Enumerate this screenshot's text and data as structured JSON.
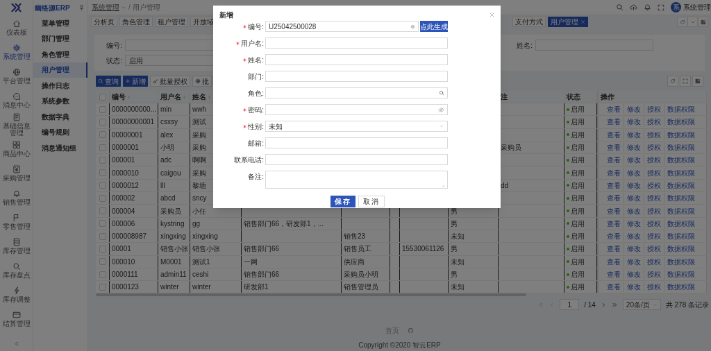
{
  "app": {
    "logo_text": "幽络源ERP"
  },
  "rail": [
    {
      "label": "仪表板",
      "selected": false
    },
    {
      "label": "系统管理",
      "selected": true
    },
    {
      "label": "平台管理",
      "selected": false
    },
    {
      "label": "消息中心",
      "selected": false
    },
    {
      "label": "基础信息管理",
      "selected": false
    },
    {
      "label": "商品中心",
      "selected": false
    },
    {
      "label": "采购管理",
      "selected": false
    },
    {
      "label": "销售管理",
      "selected": false
    },
    {
      "label": "零售管理",
      "selected": false
    },
    {
      "label": "库存管理",
      "selected": false
    },
    {
      "label": "库存盘点",
      "selected": false
    },
    {
      "label": "库存调整",
      "selected": false
    },
    {
      "label": "结算管理",
      "selected": false
    }
  ],
  "submenu": [
    {
      "label": "菜单管理",
      "selected": false
    },
    {
      "label": "部门管理",
      "selected": false
    },
    {
      "label": "角色管理",
      "selected": false
    },
    {
      "label": "用户管理",
      "selected": true
    },
    {
      "label": "操作日志",
      "selected": false
    },
    {
      "label": "系统参数",
      "selected": false
    },
    {
      "label": "数据字典",
      "selected": false
    },
    {
      "label": "编号规则",
      "selected": false
    },
    {
      "label": "消息通知组",
      "selected": false
    }
  ],
  "topbar": {
    "breadcrumb": [
      "系统管理",
      "用户管理"
    ],
    "separator": "/",
    "user_initial": "系",
    "user_name": "系统管理"
  },
  "tabs": [
    {
      "label": "分析页",
      "selected": false
    },
    {
      "label": "角色管理",
      "selected": false
    },
    {
      "label": "租户管理",
      "selected": false
    },
    {
      "label": "开放域",
      "selected": false
    },
    {
      "label": "支付方式",
      "selected": false
    },
    {
      "label": "用户管理",
      "selected": true,
      "closable": true
    }
  ],
  "filters": {
    "id_label": "编号:",
    "name_label": "姓名:",
    "status_label": "状态:",
    "status_value": "启用"
  },
  "toolbar": [
    "查询",
    "新增",
    "批量授权",
    "批"
  ],
  "table": {
    "header_checked": false,
    "headers": {
      "id": {
        "label": "编号",
        "sortable": true
      },
      "username": {
        "label": "用户名",
        "sortable": true
      },
      "name": {
        "label": "姓名",
        "sortable": true
      },
      "remark": {
        "label": "注"
      },
      "status": {
        "label": "状态"
      },
      "actions": {
        "label": "操作"
      }
    },
    "rows": [
      {
        "checked": false,
        "id": "0000000000...",
        "username": "min",
        "name": "wwh",
        "status": "启用",
        "enabled": true,
        "actions": [
          "查看",
          "修改",
          "授权",
          "数据权限"
        ]
      },
      {
        "checked": false,
        "id": "00000000001",
        "username": "csxsy",
        "name": "测试",
        "status": "启用",
        "enabled": true,
        "actions": [
          "查看",
          "修改",
          "授权",
          "数据权限"
        ]
      },
      {
        "checked": false,
        "id": "00000001",
        "username": "alex",
        "name": "采购",
        "status": "启用",
        "enabled": true,
        "actions": [
          "查看",
          "修改",
          "授权",
          "数据权限"
        ]
      },
      {
        "checked": false,
        "id": "0000001",
        "username": "小明",
        "name": "采购",
        "remark": "采购员",
        "status": "启用",
        "enabled": true,
        "actions": [
          "查看",
          "修改",
          "授权",
          "数据权限"
        ]
      },
      {
        "checked": false,
        "id": "000001",
        "username": "adc",
        "name": "啊啊",
        "status": "启用",
        "enabled": true,
        "actions": [
          "查看",
          "修改",
          "授权",
          "数据权限"
        ]
      },
      {
        "checked": false,
        "id": "0000010",
        "username": "caigou",
        "name": "采购",
        "status": "启用",
        "enabled": true,
        "actions": [
          "查看",
          "修改",
          "授权",
          "数据权限"
        ]
      },
      {
        "checked": false,
        "id": "0000012",
        "username": "lll",
        "name": "黎塘",
        "remark": "dd",
        "status": "启用",
        "enabled": true,
        "actions": [
          "查看",
          "修改",
          "授权",
          "数据权限"
        ]
      },
      {
        "checked": false,
        "id": "000002",
        "username": "abcd",
        "name": "sncy",
        "status": "启用",
        "enabled": true,
        "actions": [
          "查看",
          "修改",
          "授权",
          "数据权限"
        ]
      },
      {
        "checked": false,
        "id": "000004",
        "username": "采购员",
        "name": "小任",
        "gender": "男",
        "status": "启用",
        "enabled": true,
        "actions": [
          "查看",
          "修改",
          "授权",
          "数据权限"
        ]
      },
      {
        "checked": false,
        "id": "000006",
        "username": "kystring",
        "name": "gg",
        "dept": "销售部门66，研发部1，...",
        "gender": "男",
        "status": "启用",
        "enabled": true,
        "actions": [
          "查看",
          "修改",
          "授权",
          "数据权限"
        ]
      },
      {
        "checked": false,
        "id": "000008987",
        "username": "xingxing",
        "name": "xingxing",
        "role": "销售23",
        "gender": "未知",
        "status": "启用",
        "enabled": true,
        "actions": [
          "查看",
          "修改",
          "授权",
          "数据权限"
        ]
      },
      {
        "checked": false,
        "id": "00001",
        "username": "销售小张",
        "name": "销售小张",
        "dept": "销售部门66",
        "role": "销售员工",
        "phone": "15530061126",
        "gender": "男",
        "status": "启用",
        "enabled": true,
        "actions": [
          "查看",
          "修改",
          "授权",
          "数据权限"
        ]
      },
      {
        "checked": false,
        "id": "000010",
        "username": "M0001",
        "name": "测试1",
        "dept": "一网",
        "role": "供应商",
        "gender": "未知",
        "status": "启用",
        "enabled": true,
        "actions": [
          "查看",
          "修改",
          "授权",
          "数据权限"
        ]
      },
      {
        "checked": false,
        "id": "0000111",
        "username": "admin11",
        "name": "ceshi",
        "dept": "销售部门66",
        "role": "采购员小明",
        "gender": "男",
        "status": "启用",
        "enabled": true,
        "actions": [
          "查看",
          "修改",
          "授权",
          "数据权限"
        ]
      },
      {
        "checked": false,
        "id": "0000123",
        "username": "winter",
        "name": "winter",
        "dept": "研发部1",
        "role": "销售管理员",
        "gender": "未知",
        "status": "启用",
        "enabled": true,
        "actions": [
          "查看",
          "修改",
          "授权",
          "数据权限"
        ]
      }
    ]
  },
  "pagination": {
    "page": "1",
    "total_pages": "/ 14",
    "page_size": "20条/页",
    "total": "共 278 条记录"
  },
  "footer": {
    "link": "首页",
    "copyright": "Copyright ©2020 智云ERP"
  },
  "dialog": {
    "title": "新增",
    "fields": [
      {
        "label": "编号:",
        "required": true,
        "kind": "text",
        "value": "U25042500028",
        "clearable": true,
        "button": "点此生成"
      },
      {
        "label": "用户名:",
        "required": true,
        "kind": "text"
      },
      {
        "label": "姓名:",
        "required": true,
        "kind": "text"
      },
      {
        "label": "部门:",
        "required": false,
        "kind": "text"
      },
      {
        "label": "角色:",
        "required": false,
        "kind": "search"
      },
      {
        "label": "密码:",
        "required": true,
        "kind": "password"
      },
      {
        "label": "性别:",
        "required": true,
        "kind": "select",
        "value": "未知"
      },
      {
        "label": "邮箱:",
        "required": false,
        "kind": "text"
      },
      {
        "label": "联系电话:",
        "required": false,
        "kind": "text"
      },
      {
        "label": "备注:",
        "required": false,
        "kind": "textarea"
      }
    ],
    "buttons": [
      {
        "label": "保存",
        "primary": true
      },
      {
        "label": "取消",
        "primary": false
      }
    ]
  }
}
